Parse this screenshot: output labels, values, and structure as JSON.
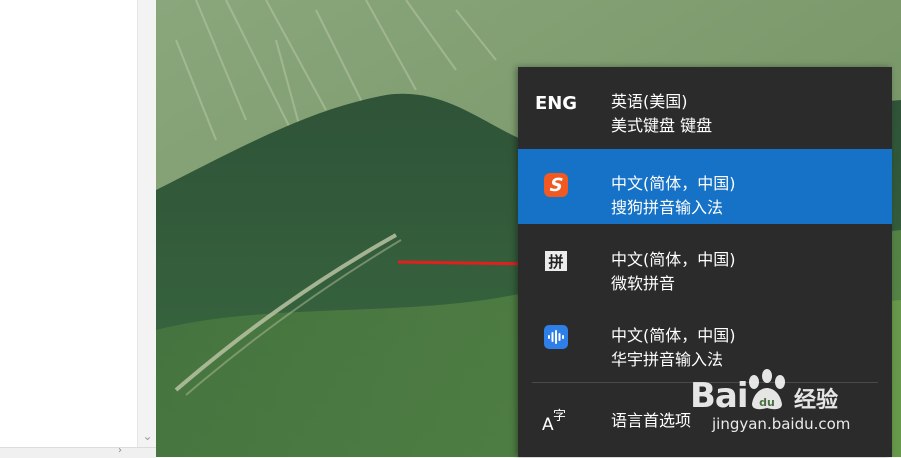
{
  "flyout": {
    "items": [
      {
        "icon": "eng-text-icon",
        "icon_text": "ENG",
        "line1": "英语(美国)",
        "line2": "美式键盘 键盘",
        "selected": false
      },
      {
        "icon": "sogou-icon",
        "icon_text": "S",
        "line1": "中文(简体，中国)",
        "line2": "搜狗拼音输入法",
        "selected": true
      },
      {
        "icon": "pin-icon",
        "icon_text": "拼",
        "line1": "中文(简体，中国)",
        "line2": "微软拼音",
        "selected": false
      },
      {
        "icon": "huayu-icon",
        "icon_text": "",
        "line1": "中文(简体，中国)",
        "line2": "华宇拼音输入法",
        "selected": false
      }
    ],
    "preferences": {
      "icon_a": "A",
      "icon_zi": "字",
      "label": "语言首选项"
    }
  },
  "watermark": {
    "logo_left": "Bai",
    "logo_right": "经验",
    "url": "jingyan.baidu.com"
  },
  "colors": {
    "flyout_bg": "#2b2b2b",
    "selected_bg": "#1572c6",
    "sogou_orange": "#f05a22",
    "huayu_blue": "#2f7fe8",
    "arrow_red": "#e0201f"
  }
}
